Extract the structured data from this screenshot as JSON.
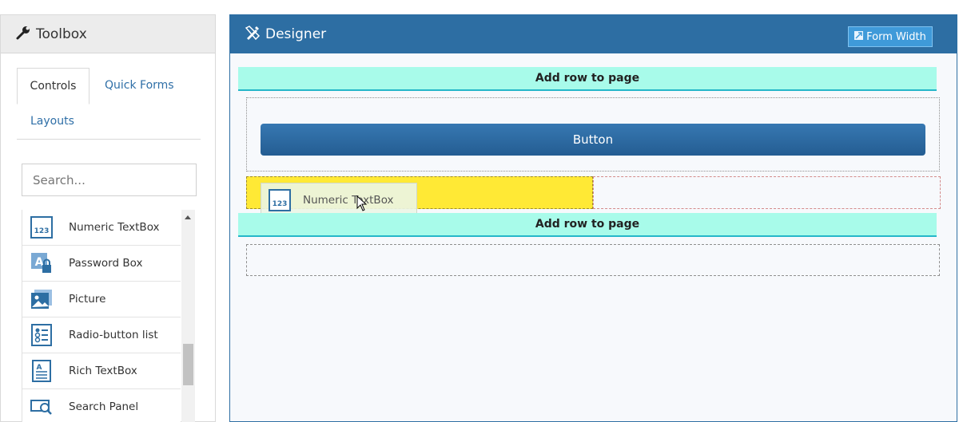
{
  "toolbox": {
    "title": "Toolbox",
    "icon": "wrench-icon",
    "tabs": [
      {
        "label": "Controls",
        "active": true
      },
      {
        "label": "Quick Forms",
        "active": false
      },
      {
        "label": "Layouts",
        "active": false
      }
    ],
    "search": {
      "placeholder": "Search..."
    },
    "items": [
      {
        "label": "Numeric TextBox",
        "icon": "numeric-textbox-icon"
      },
      {
        "label": "Password Box",
        "icon": "password-box-icon"
      },
      {
        "label": "Picture",
        "icon": "picture-icon"
      },
      {
        "label": "Radio-button list",
        "icon": "radio-list-icon"
      },
      {
        "label": "Rich TextBox",
        "icon": "rich-textbox-icon"
      },
      {
        "label": "Search Panel",
        "icon": "search-panel-icon"
      }
    ]
  },
  "designer": {
    "title": "Designer",
    "icon": "pencil-ruler-icon",
    "form_width_label": "Form Width",
    "add_row_label": "Add row to page",
    "button_label": "Button",
    "drag_item_label": "Numeric TextBox",
    "numeric_icon_text": "123"
  },
  "colors": {
    "designer_header": "#2d6ea3",
    "add_row_bg": "#a8fbea",
    "drop_highlight": "#ffe935"
  }
}
